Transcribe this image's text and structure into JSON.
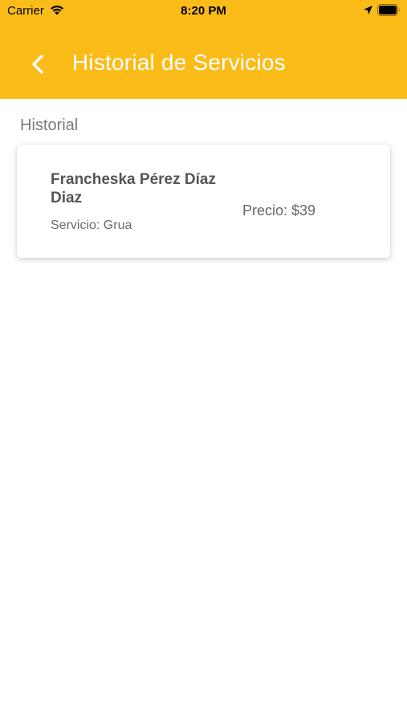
{
  "status_bar": {
    "carrier": "Carrier",
    "time": "8:20 PM"
  },
  "header": {
    "title": "Historial de Servicios",
    "background_color": "#FBBC1A",
    "back_icon": "chevron-left-icon"
  },
  "section": {
    "label": "Historial"
  },
  "history": [
    {
      "client_name": "Francheska Pérez Díaz Diaz",
      "service": "Servicio: Grua",
      "price": "Precio: $39"
    }
  ]
}
